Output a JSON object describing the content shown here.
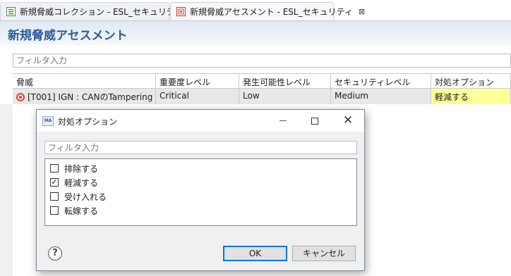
{
  "tabs": [
    {
      "label": "新規脅威コレクション - ESL_セキュリティ",
      "icon": "list-icon",
      "active": false
    },
    {
      "label": "新規脅威アセスメント - ESL_セキュリティ",
      "icon": "assessment-icon",
      "active": true,
      "close": "⊠"
    }
  ],
  "page": {
    "title": "新規脅威アセスメント"
  },
  "filter": {
    "placeholder": "フィルタ入力"
  },
  "table": {
    "headers": [
      "脅威",
      "重要度レベル",
      "発生可能性レベル",
      "セキュリティレベル",
      "対処オプション"
    ],
    "rows": [
      {
        "threat": "[T001] IGN : CANのTampering",
        "severity": "Critical",
        "likelihood": "Low",
        "security": "Medium",
        "option": "軽減する",
        "highlight": "#ffff99"
      }
    ]
  },
  "dialog": {
    "title": "対処オプション",
    "icon_text": "MA",
    "filter_placeholder": "フィルタ入力",
    "options": [
      {
        "label": "排除する",
        "checked": false
      },
      {
        "label": "軽減する",
        "checked": true
      },
      {
        "label": "受け入れる",
        "checked": false
      },
      {
        "label": "転嫁する",
        "checked": false
      }
    ],
    "help": "?",
    "ok": "OK",
    "cancel": "キャンセル"
  },
  "colors": {
    "title": "#2a5c9a",
    "highlight": "#ffff99",
    "ok_border": "#0078d7"
  }
}
